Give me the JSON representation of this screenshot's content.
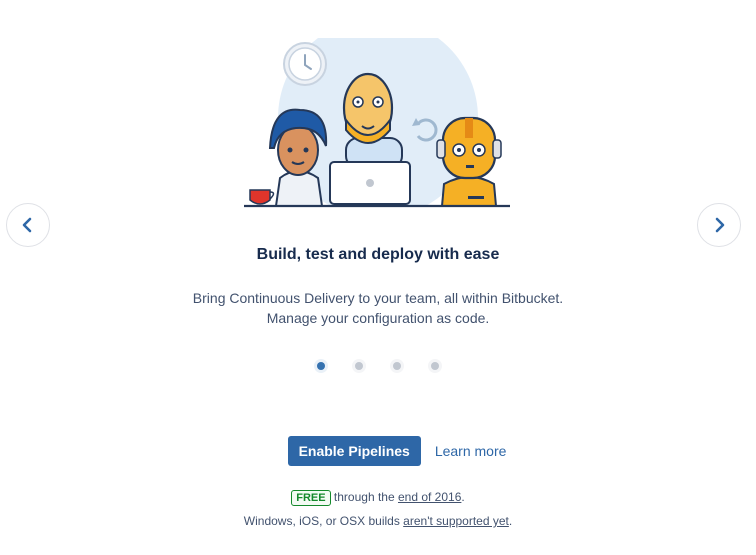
{
  "carousel": {
    "prev_icon": "chevron-left-icon",
    "next_icon": "chevron-right-icon",
    "slide_count": 4,
    "active_slide": 1
  },
  "slide": {
    "title": "Build, test and deploy with ease",
    "description_line1": "Bring Continuous Delivery to your team, all within Bitbucket.",
    "description_line2": "Manage your configuration as code."
  },
  "actions": {
    "enable_label": "Enable Pipelines",
    "learn_more_label": "Learn more"
  },
  "footnotes": {
    "badge": "FREE",
    "through_text": " through the ",
    "end_link": "end of 2016",
    "period": ".",
    "builds_text": "Windows, iOS, or OSX builds ",
    "unsupported_link": "aren't supported yet",
    "period2": "."
  },
  "colors": {
    "primary": "#2e67a7",
    "free_badge": "#14892c",
    "robot": "#f5b025",
    "backdrop": "#deebf7"
  }
}
